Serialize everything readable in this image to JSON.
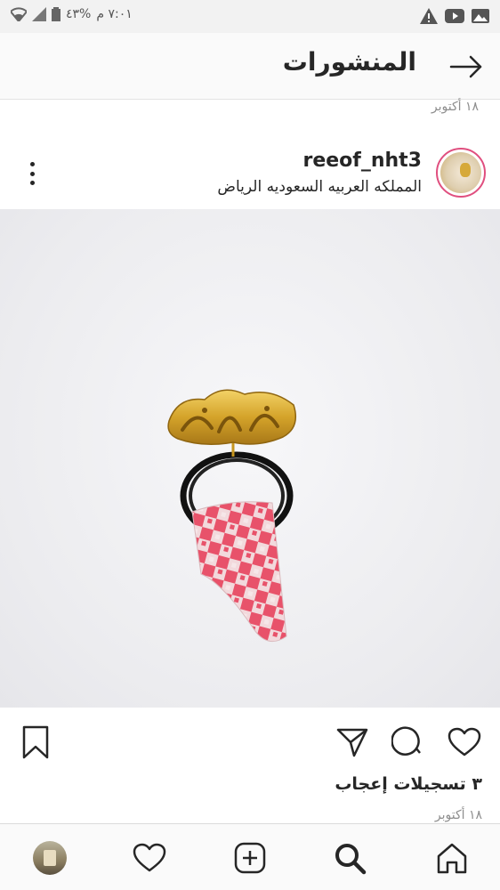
{
  "status_bar": {
    "time": "٧:٠١ م",
    "battery": "%٤٣",
    "icons": [
      "signal-icon",
      "wifi-icon",
      "battery-icon",
      "warning-icon",
      "youtube-icon",
      "gallery-icon"
    ]
  },
  "header": {
    "title": "المنشورات",
    "back_icon": "arrow-right-icon"
  },
  "date_top": "١٨ أكتوبر",
  "post": {
    "username": "reeof_nht3",
    "location": "المملكه العربيه السعوديه الرياض",
    "image_pendant_text": "مازن",
    "likes": "٣ تسجيلات إعجاب",
    "date": "١٨ أكتوبر"
  },
  "actions": {
    "icons": [
      "heart-icon",
      "comment-icon",
      "send-icon",
      "bookmark-icon"
    ]
  },
  "bottom_nav": {
    "icons": [
      "home-icon",
      "search-icon",
      "add-icon",
      "activity-heart-icon",
      "profile-avatar"
    ]
  },
  "colors": {
    "avatar_ring": "#e04f7f",
    "pendant_gold": "#d4a32a",
    "shemagh_red": "#e8526a",
    "text": "#262626",
    "muted": "#8e8e8e"
  }
}
